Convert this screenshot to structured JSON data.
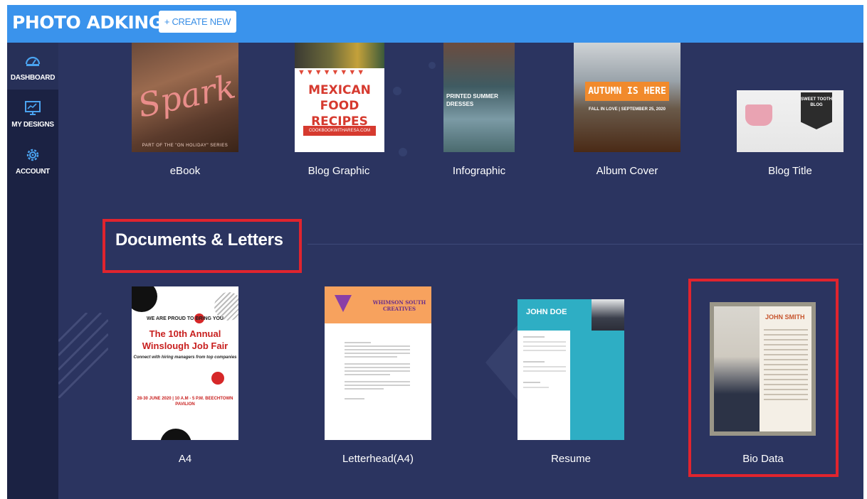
{
  "app": {
    "logo_text": "PHOTO ADKING",
    "create_button": "+ CREATE NEW"
  },
  "sidebar": {
    "items": [
      {
        "label": "DASHBOARD",
        "icon": "gauge-icon",
        "active": true
      },
      {
        "label": "MY DESIGNS",
        "icon": "monitor-icon",
        "active": false
      },
      {
        "label": "ACCOUNT",
        "icon": "gear-icon",
        "active": false
      }
    ]
  },
  "marketing_row": [
    {
      "label": "eBook",
      "thumb_text": "Spark",
      "thumb_caption": "PART OF THE \"ON HOLIDAY\" SERIES"
    },
    {
      "label": "Blog Graphic",
      "thumb_text": "MEXICAN FOOD RECIPES",
      "thumb_caption": "COOKBOOKWITHARESA.COM"
    },
    {
      "label": "Infographic",
      "thumb_text": "PRINTED SUMMER DRESSES"
    },
    {
      "label": "Album Cover",
      "thumb_text": "AUTUMN IS HERE",
      "thumb_caption": "FALL IN LOVE | SEPTEMBER 25, 2020"
    },
    {
      "label": "Blog Title",
      "thumb_text": "SWEET TOOTH BLOG"
    }
  ],
  "documents_section": {
    "heading": "Documents & Letters",
    "items": [
      {
        "label": "A4",
        "thumb_pre": "WE ARE PROUD TO BRING YOU",
        "thumb_title": "The 10th Annual Winslough Job Fair",
        "thumb_tagline": "Connect with hiring managers from top companies",
        "thumb_date": "28-30 JUNE 2020 | 10 A.M - 5 P.M. BEECHTOWN PAVILION"
      },
      {
        "label": "Letterhead(A4)",
        "thumb_brand": "WHIMSON SOUTH CREATIVES"
      },
      {
        "label": "Resume",
        "thumb_name": "JOHN DOE"
      },
      {
        "label": "Bio Data",
        "thumb_name": "JOHN SMITH"
      }
    ]
  },
  "colors": {
    "topbar": "#3a93ec",
    "sidebar": "#1b2243",
    "content_bg": "#2b3460",
    "highlight": "#e0242e"
  }
}
